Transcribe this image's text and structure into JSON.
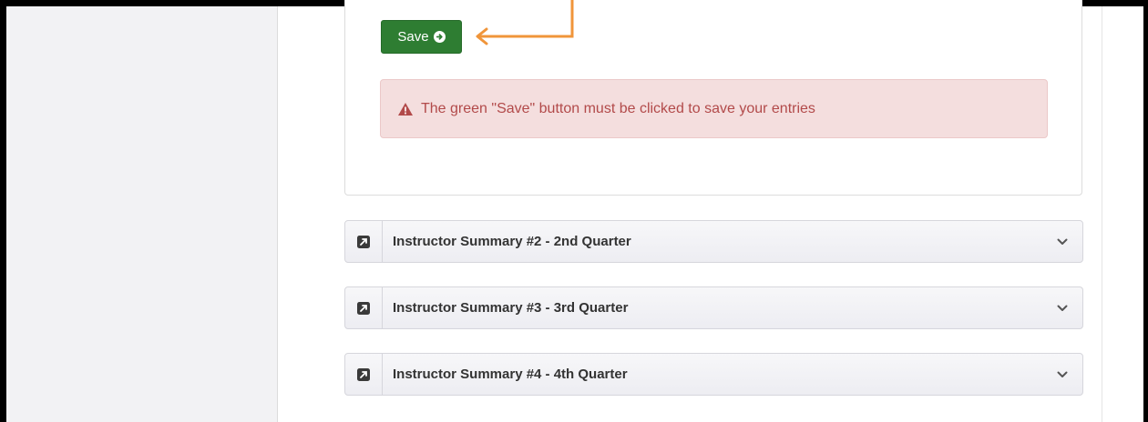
{
  "form": {
    "save_label": "Save",
    "alert_text": "The green \"Save\" button must be clicked to save your entries"
  },
  "accordion": {
    "items": [
      {
        "label": "Instructor Summary #2 - 2nd Quarter"
      },
      {
        "label": "Instructor Summary #3 - 3rd Quarter"
      },
      {
        "label": "Instructor Summary #4 - 4th Quarter"
      }
    ]
  },
  "colors": {
    "save_button": "#2e7d32",
    "alert_background": "#f4dede",
    "alert_text": "#b24a4a",
    "annotation_arrow": "#f0953a"
  },
  "icons": {
    "save": "arrow-circle-right-icon",
    "alert": "warning-triangle-icon",
    "accordion_item": "external-link-square-icon",
    "accordion_toggle": "chevron-down-icon"
  }
}
